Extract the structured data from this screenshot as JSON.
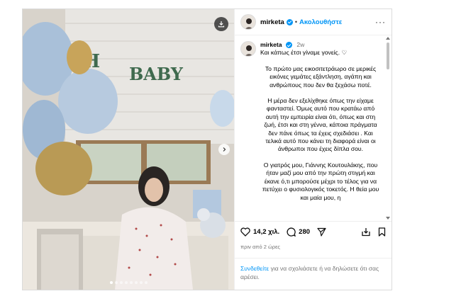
{
  "post": {
    "username": "mirketa",
    "follow_label": "Ακολουθήστε",
    "separator": "•",
    "more_label": "···",
    "media": {
      "banner_text_1": "OH",
      "banner_text_2": "BABY",
      "slide_count": 8,
      "active_slide": 0
    },
    "caption": {
      "username": "mirketa",
      "time": "2w",
      "first_line": "Και κάπως έτσι γίναμε γονείς. ♡",
      "paragraphs": [
        "Το πρώτο μας εικοσιτετράωρο σε μερικές εικόνες γεμάτες εξάντληση, αγάπη και ανθρώπους που δεν θα ξεχάσω ποτέ.",
        "Η μέρα δεν εξελίχθηκε όπως την είχαμε φανταστεί. Όμως αυτό που κρατάω από αυτή την εμπειρία είναι ότι, όπως και στη ζωή, έτσι και στη γέννα, κάποια πράγματα δεν πάνε όπως τα έχεις σχεδιάσει . Και τελικά αυτό που κάνει τη διαφορά είναι οι άνθρωποι που έχεις δίπλα σου.",
        "Ο γιατρός μου, Γιάννης Κουτουλάκης, που ήταν μαζί μου από την πρώτη στιγμή και έκανε ό,τι μπορούσε μέχρι το τέλος για να πετύχει ο φυσιολογικός τοκετός. Η θεία μου και μαία μου, η"
      ]
    },
    "likes": "14,2 χιλ.",
    "comments": "280",
    "timestamp": "πριν από 2 ώρες",
    "login": {
      "link": "Συνδεθείτε",
      "rest": "για να σχολιάσετε ή να δηλώσετε ότι σας αρέσει."
    }
  },
  "colors": {
    "accent": "#0095f6",
    "muted": "#737373",
    "border": "#dbdbdb"
  },
  "icons": [
    "download-icon",
    "chevron-right-icon",
    "verified-badge-icon",
    "heart-icon",
    "comment-icon",
    "share-icon",
    "repost-icon",
    "bookmark-icon",
    "more-icon"
  ]
}
